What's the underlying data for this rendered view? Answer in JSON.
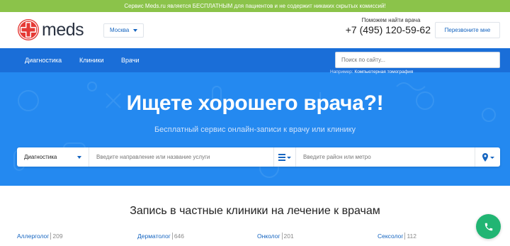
{
  "promo": {
    "text": "Сервис Meds.ru является БЕСПЛАТНЫМ для пациентов и не содержит никаких скрытых комиссий!"
  },
  "header": {
    "logo_text": "meds",
    "city": "Москва",
    "help_text": "Поможем найти врача",
    "phone": "+7 (495) 120-59-62",
    "callback_label": "Перезвоните мне"
  },
  "nav": {
    "items": [
      {
        "label": "Диагностика"
      },
      {
        "label": "Клиники"
      },
      {
        "label": "Врачи"
      }
    ],
    "search_placeholder": "Поиск по сайту...",
    "example_prefix": "Например:",
    "example_link": "Компьютерная томография"
  },
  "hero": {
    "title": "Ищете хорошего врача?!",
    "subtitle": "Бесплатный сервис онлайн-записи к врачу или клинику",
    "category_select": "Диагностика",
    "service_placeholder": "Введите направление или название услуги",
    "location_placeholder": "Введите район или метро"
  },
  "section": {
    "title": "Запись в частные клиники на лечение к врачам",
    "specialties": [
      {
        "name": "Аллерголог",
        "count": "209"
      },
      {
        "name": "Дерматолог",
        "count": "646"
      },
      {
        "name": "Онколог",
        "count": "201"
      },
      {
        "name": "Сексолог",
        "count": "112"
      }
    ]
  },
  "colors": {
    "promo_green": "#8bc34a",
    "nav_blue": "#1a6ed8",
    "hero_blue": "#2489f0",
    "link_blue": "#1565c0",
    "logo_red": "#e53935",
    "fab_green": "#21b573"
  },
  "icons": [
    "medical-cross-logo-icon",
    "chevron-down-icon",
    "list-icon",
    "location-pin-icon",
    "phone-icon"
  ]
}
